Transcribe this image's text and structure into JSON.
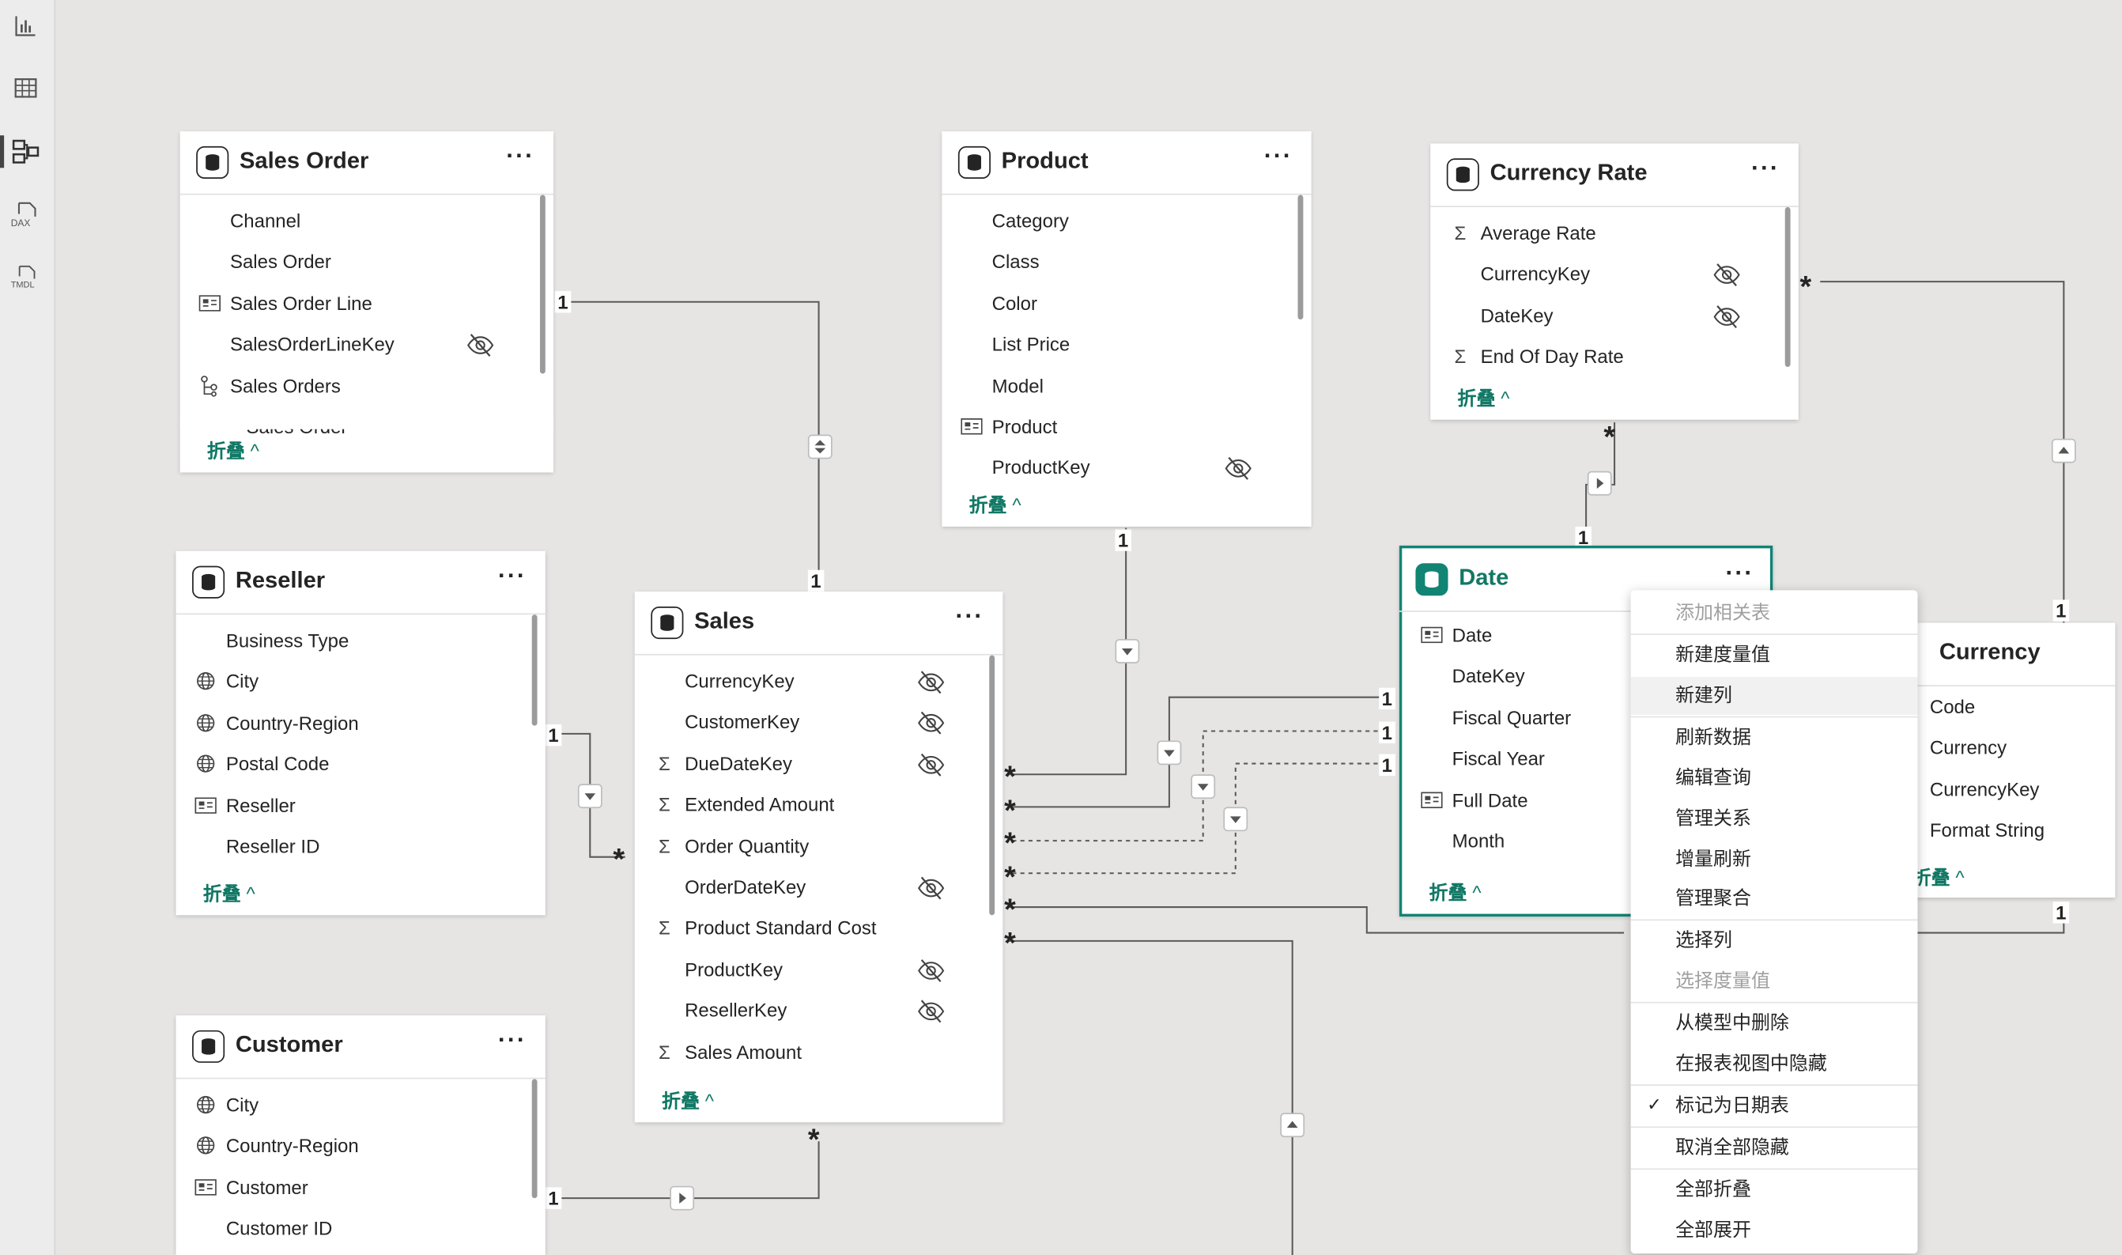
{
  "rail": {
    "icons": [
      "report-view-icon",
      "table-view-icon",
      "model-view-icon",
      "dax-query-icon",
      "tmdl-view-icon"
    ],
    "dax_label": "DAX",
    "tmdl_label": "TMDL"
  },
  "more_label": "···",
  "collapse_label": "折叠",
  "tables": {
    "sales_order": {
      "title": "Sales Order",
      "fields": [
        "Channel",
        "Sales Order",
        "Sales Order Line",
        "SalesOrderLineKey",
        "Sales Orders",
        "Sales Order"
      ]
    },
    "product": {
      "title": "Product",
      "fields": [
        "Category",
        "Class",
        "Color",
        "List Price",
        "Model",
        "Product",
        "ProductKey"
      ]
    },
    "currency_rate": {
      "title": "Currency Rate",
      "fields": [
        "Average Rate",
        "CurrencyKey",
        "DateKey",
        "End Of Day Rate"
      ]
    },
    "reseller": {
      "title": "Reseller",
      "fields": [
        "Business Type",
        "City",
        "Country-Region",
        "Postal Code",
        "Reseller",
        "Reseller ID"
      ]
    },
    "sales": {
      "title": "Sales",
      "fields": [
        "CurrencyKey",
        "CustomerKey",
        "DueDateKey",
        "Extended Amount",
        "Order Quantity",
        "OrderDateKey",
        "Product Standard Cost",
        "ProductKey",
        "ResellerKey",
        "Sales Amount"
      ]
    },
    "date": {
      "title": "Date",
      "fields": [
        "Date",
        "DateKey",
        "Fiscal Quarter",
        "Fiscal Year",
        "Full Date",
        "Month"
      ]
    },
    "currency": {
      "title": "Currency",
      "fields": [
        "Code",
        "Currency",
        "CurrencyKey",
        "Format String"
      ]
    },
    "customer": {
      "title": "Customer",
      "fields": [
        "City",
        "Country-Region",
        "Customer",
        "Customer ID"
      ]
    }
  },
  "relationship_labels": {
    "one": "1",
    "many": "*"
  },
  "context_menu": {
    "items": [
      {
        "label": "添加相关表",
        "disabled": true
      },
      {
        "label": "新建度量值"
      },
      {
        "label": "新建列"
      },
      {
        "label": "刷新数据"
      },
      {
        "label": "编辑查询"
      },
      {
        "label": "管理关系"
      },
      {
        "label": "增量刷新"
      },
      {
        "label": "管理聚合"
      },
      {
        "label": "选择列"
      },
      {
        "label": "选择度量值",
        "disabled": true
      },
      {
        "label": "从模型中删除"
      },
      {
        "label": "在报表视图中隐藏"
      },
      {
        "label": "标记为日期表",
        "checked": true
      },
      {
        "label": "取消全部隐藏"
      },
      {
        "label": "全部折叠"
      },
      {
        "label": "全部展开"
      }
    ],
    "check_glyph": "✓"
  }
}
